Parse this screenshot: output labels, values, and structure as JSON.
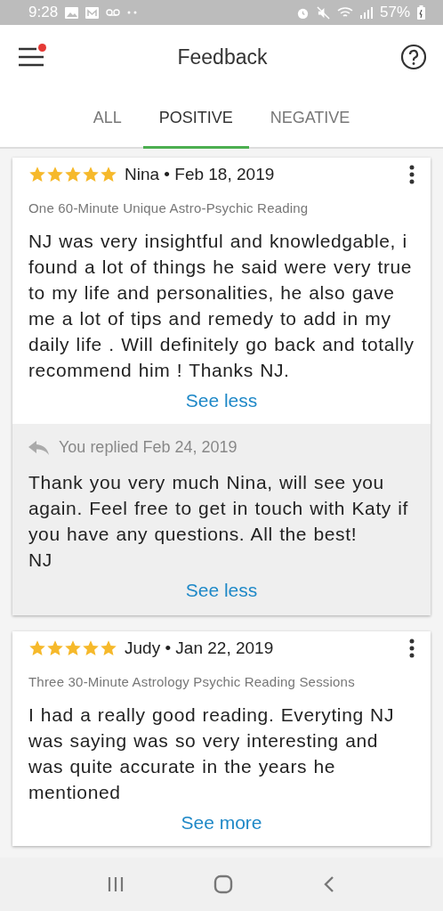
{
  "status_bar": {
    "time": "9:28",
    "battery": "57%"
  },
  "header": {
    "title": "Feedback",
    "menu_has_notification": true
  },
  "tabs": [
    {
      "label": "ALL",
      "selected": false
    },
    {
      "label": "POSITIVE",
      "selected": true
    },
    {
      "label": "NEGATIVE",
      "selected": false
    }
  ],
  "reviews": [
    {
      "stars": 5,
      "byline": "Nina • Feb 18, 2019",
      "product": "One 60-Minute Unique Astro-Psychic Reading",
      "text": "NJ was very insightful and knowledgable, i found a lot of things he said were very true to my life and personalities, he also gave me a lot of tips and remedy to add in my daily life . Will definitely go back and totally recommend him ! Thanks NJ.",
      "toggle": "See less",
      "reply": {
        "header": "You replied Feb 24, 2019",
        "lines": [
          "Thank you very much Nina, will see you again. Feel free to get in touch with Katy if you have any questions. All the best!",
          "NJ"
        ],
        "toggle": "See less"
      }
    },
    {
      "stars": 5,
      "byline": "Judy • Jan 22, 2019",
      "product": "Three 30-Minute Astrology Psychic Reading Sessions",
      "text": "I had a really good reading. Everyting NJ was saying was so very interesting and was quite accurate in the years he mentioned",
      "toggle": "See more"
    }
  ]
}
